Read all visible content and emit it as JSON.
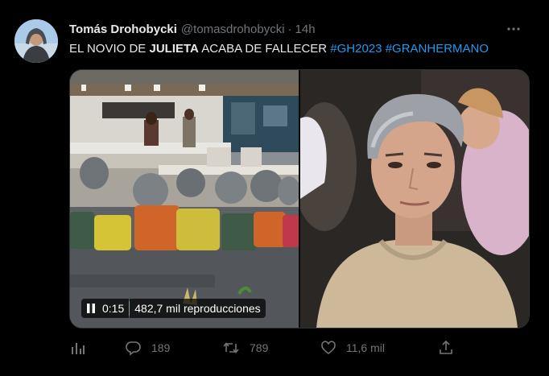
{
  "tweet": {
    "display_name": "Tomás Drohobycki",
    "handle": "@tomasdrohobycki",
    "separator": "·",
    "time": "14h",
    "text_part1": "EL NOVIO DE ",
    "text_bold": "JULIETA",
    "text_part2": " ACABA DE FALLECER ",
    "hashtag1": "#GH2023",
    "hashtag2": "#GRANHERMANO"
  },
  "video": {
    "elapsed": "0:15",
    "views": "482,7 mil reproducciones"
  },
  "actions": {
    "replies": "189",
    "retweets": "789",
    "likes": "11,6 mil"
  },
  "colors": {
    "background": "#000000",
    "text": "#e7e9ea",
    "muted": "#71767b",
    "hashtag": "#1d9bf0"
  },
  "icons": [
    "avatar",
    "more-icon",
    "pause-icon",
    "analytics-icon",
    "reply-icon",
    "retweet-icon",
    "like-icon",
    "share-icon"
  ]
}
